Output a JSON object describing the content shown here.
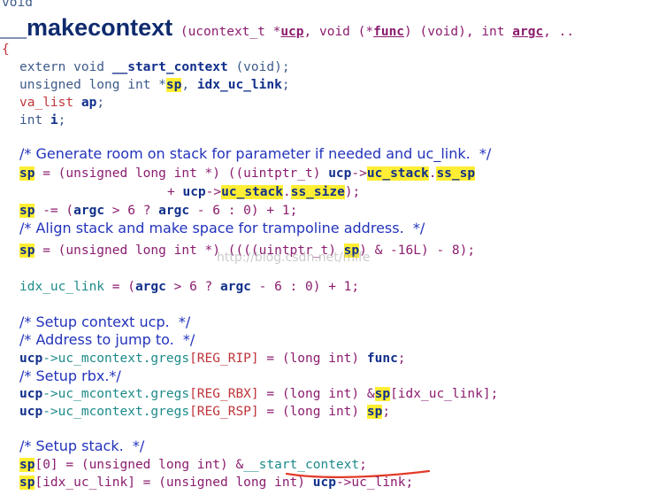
{
  "header": {
    "ret_type": "void",
    "func_name": "__makecontext",
    "sig_open": " (ucontext_t *",
    "sig_ucp": "ucp",
    "sig_mid": ", void (*",
    "sig_func": "func",
    "sig_mid2": ") (void), int ",
    "sig_argc": "argc",
    "sig_end": ", .."
  },
  "code": {
    "brace": "{",
    "l1_a": "extern void ",
    "l1_b": "__start_context",
    "l1_c": " (void);",
    "l2_a": "unsigned long int *",
    "l2_sp": "sp",
    "l2_b": ", ",
    "l2_c": "idx_uc_link",
    "l2_d": ";",
    "l3_a": "va_list",
    "l3_b": " ap",
    "l3_c": ";",
    "l4_a": "int ",
    "l4_b": "i",
    "l4_c": ";",
    "c1": "/* Generate room on stack for parameter if needed and uc_link.  */",
    "l5_sp": "sp",
    "l5_a": " = (unsigned long int *) ((uintptr_t) ",
    "l5_ucp": "ucp",
    "l5_arrow": "->",
    "l5_ucst": "uc_stack",
    "l5_dot": ".",
    "l5_sssp": "ss_sp",
    "l6_a": "+ ",
    "l6_ucp": "ucp",
    "l6_arrow": "->",
    "l6_ucst": "uc_stack",
    "l6_dot": ".",
    "l6_size": "ss_size",
    "l6_b": ");",
    "l7_sp": "sp",
    "l7_a": " -= (",
    "l7_argc": "argc",
    "l7_b": " > 6 ? ",
    "l7_argc2": "argc",
    "l7_c": " - 6 : 0) + 1;",
    "c2": "/* Align stack and make space for trampoline address.  */",
    "l8_sp": "sp",
    "l8_a": " = (unsigned long int *) ((((uintptr_t) ",
    "l8_sp2": "sp",
    "l8_b": ") & -16L) - 8);",
    "l9_a": "idx_uc_link",
    "l9_b": " = (",
    "l9_argc": "argc",
    "l9_c": " > 6 ? ",
    "l9_argc2": "argc",
    "l9_d": " - 6 : 0) + 1;",
    "c3": "/* Setup context ucp.  */",
    "c4": "/* Address to jump to.  */",
    "l10_ucp": "ucp",
    "l10_a": "->uc_mcontext.gregs",
    "l10_b": "[REG_RIP]",
    "l10_c": " = (long int) ",
    "l10_func": "func",
    "l10_d": ";",
    "c5": "/* Setup rbx.*/",
    "l11_ucp": "ucp",
    "l11_a": "->uc_mcontext.gregs",
    "l11_b": "[REG_RBX]",
    "l11_c": " = (long int) &",
    "l11_sp": "sp",
    "l11_d": "[idx_uc_link];",
    "l12_ucp": "ucp",
    "l12_a": "->uc_mcontext.gregs",
    "l12_b": "[REG_RSP]",
    "l12_c": " = (long int) ",
    "l12_sp": "sp",
    "l12_d": ";",
    "c6": "/* Setup stack.  */",
    "l13_sp": "sp",
    "l13_a": "[0] = (unsigned long int) &",
    "l13_b": "__start_context",
    "l13_c": ";",
    "l14_sp": "sp",
    "l14_a": "[idx_uc_link] = (unsigned long int) ",
    "l14_ucp": "ucp",
    "l14_b": "->uc_link;"
  },
  "watermark": "http://blog.csdn.net/mlfe"
}
